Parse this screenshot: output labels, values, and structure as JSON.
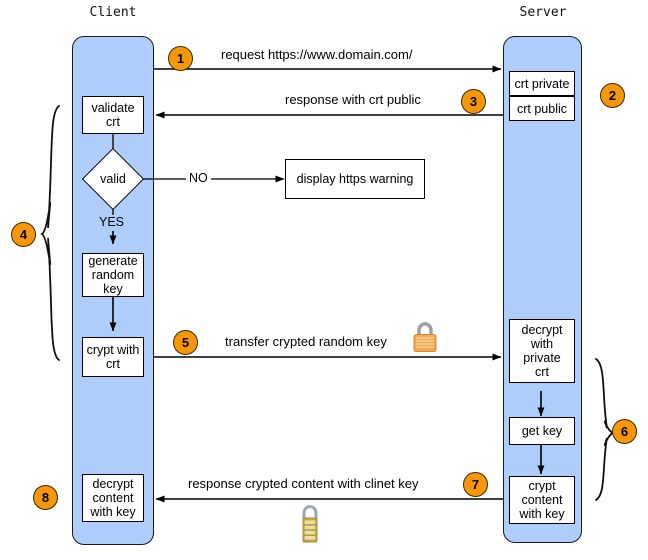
{
  "diagram": {
    "title_client": "Client",
    "title_server": "Server",
    "bg_color": "#ffffff",
    "lane_color": "#aecdfa",
    "step_color": "#f79708"
  },
  "client": {
    "boxes": [
      {
        "id": "validate-crt",
        "label": "validate\ncrt"
      },
      {
        "id": "generate-random-key",
        "label": "generate\nrandom\nkey"
      },
      {
        "id": "crypt-with-crt",
        "label": "crypt with\ncrt"
      },
      {
        "id": "decrypt-content-with-key",
        "label": "decrypt\ncontent\nwith key"
      }
    ],
    "decision": {
      "id": "valid",
      "label": "valid"
    },
    "edge_yes": "YES",
    "edge_no": "NO",
    "warning_box": "display https warning"
  },
  "server": {
    "boxes": [
      {
        "id": "crt-private",
        "label": "crt private"
      },
      {
        "id": "crt-public",
        "label": "crt public"
      },
      {
        "id": "decrypt-with-private-crt",
        "label": "decrypt\nwith\nprivate\ncrt"
      },
      {
        "id": "get-key",
        "label": "get key"
      },
      {
        "id": "crypt-content-with-key",
        "label": "crypt\ncontent\nwith key"
      }
    ]
  },
  "messages": {
    "m1": "request https://www.domain.com/",
    "m3": "response with crt public",
    "m5": "transfer crypted random key",
    "m7": "response crypted content with clinet key"
  },
  "steps": {
    "s1": "1",
    "s2": "2",
    "s3": "3",
    "s4": "4",
    "s5": "5",
    "s6": "6",
    "s7": "7",
    "s8": "8"
  },
  "icons": {
    "lock_transfer": "padlock-icon",
    "lock_response": "combination-padlock-icon"
  }
}
